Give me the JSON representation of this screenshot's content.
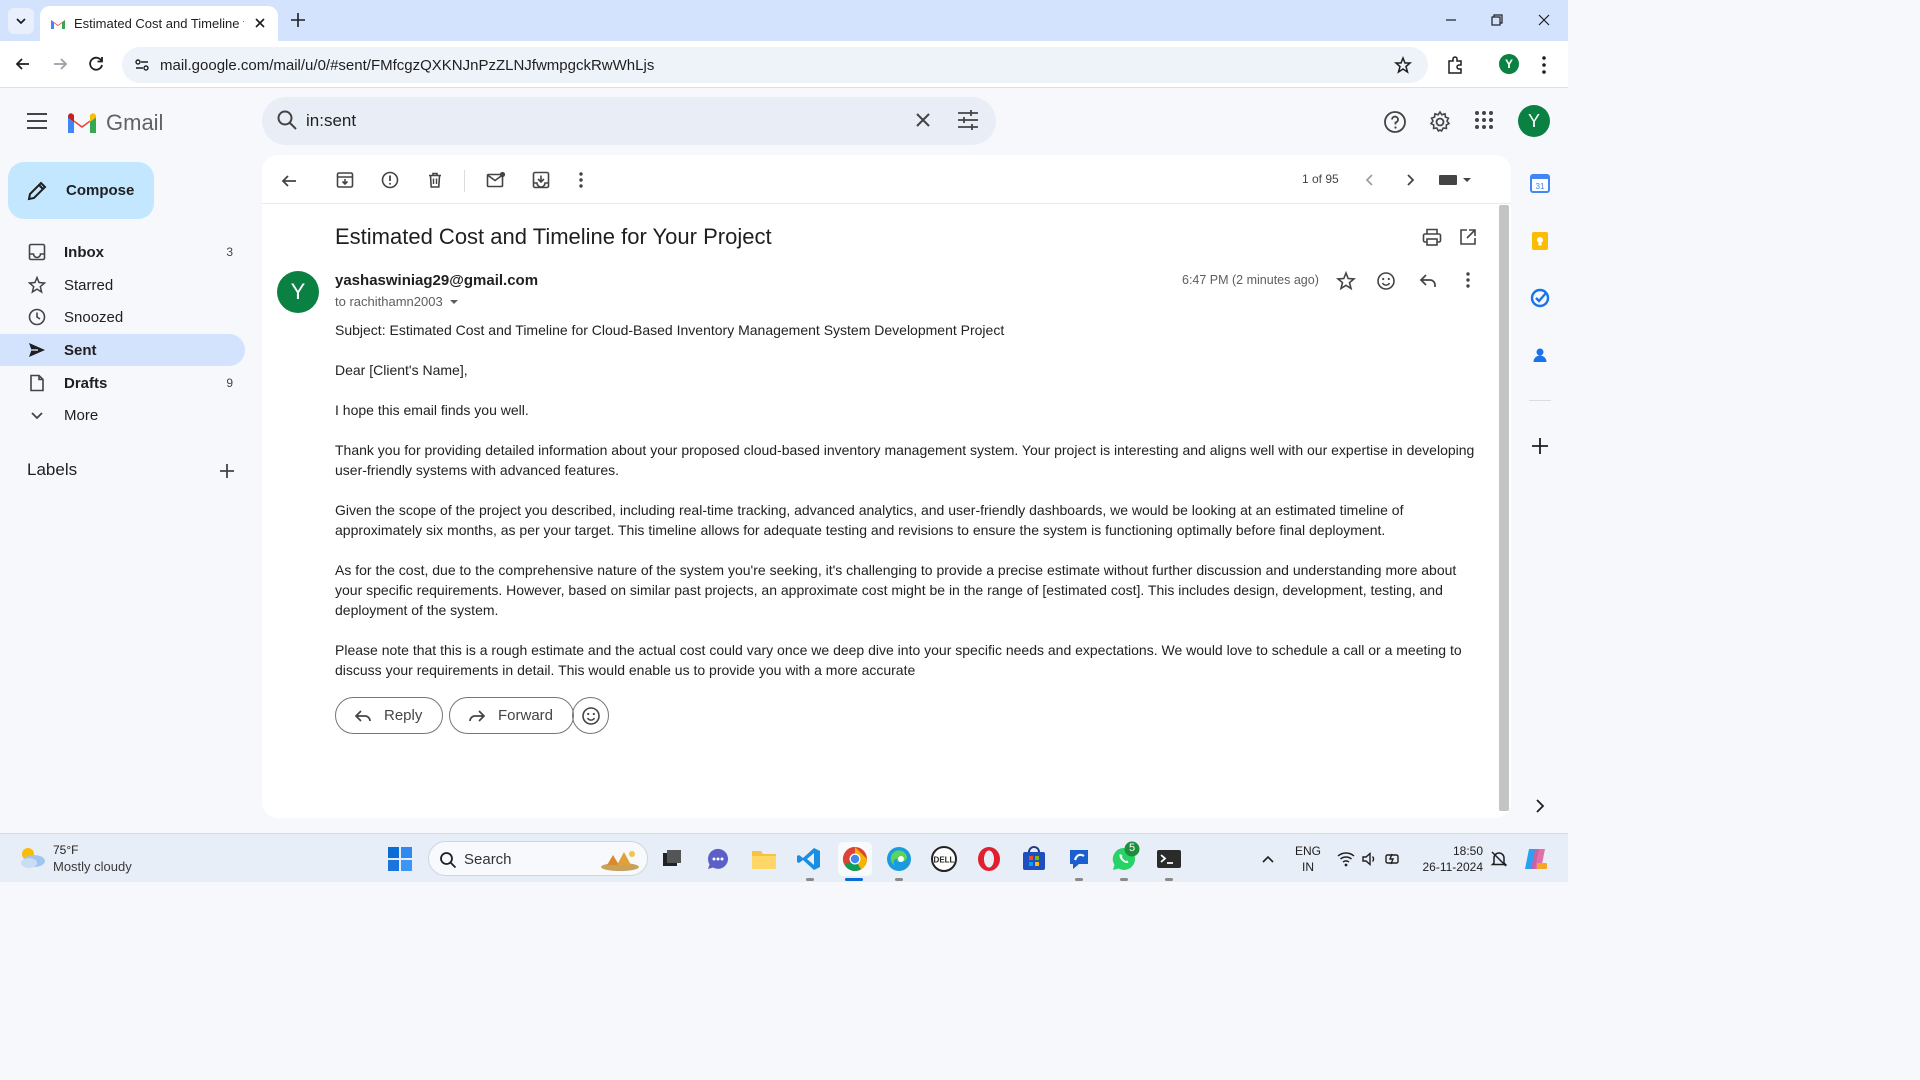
{
  "browser": {
    "tab_title": "Estimated Cost and Timeline for Your Project",
    "url": "mail.google.com/mail/u/0/#sent/FMfcgzQXKNJnPzZLNJfwmpgckRwWhLjs",
    "profile_initial": "Y"
  },
  "gmail": {
    "logo_text": "Gmail",
    "search_value": "in:sent",
    "avatar_initial": "Y",
    "compose_label": "Compose",
    "nav": [
      {
        "label": "Inbox",
        "count": "3",
        "bold": true
      },
      {
        "label": "Starred",
        "count": ""
      },
      {
        "label": "Snoozed",
        "count": ""
      },
      {
        "label": "Sent",
        "count": "",
        "bold": true,
        "active": true
      },
      {
        "label": "Drafts",
        "count": "9",
        "bold": true
      },
      {
        "label": "More",
        "count": ""
      }
    ],
    "labels_heading": "Labels",
    "pager": "1 of 95",
    "email": {
      "subject": "Estimated Cost and Timeline for Your Project",
      "sender_initial": "Y",
      "sender": "yashaswiniag29@gmail.com",
      "to": "to rachithamn2003",
      "time": "6:47 PM (2 minutes ago)",
      "body": [
        "Subject: Estimated Cost and Timeline for Cloud-Based Inventory Management System Development Project",
        "Dear [Client's Name],",
        "I hope this email finds you well.",
        "Thank you for providing detailed information about your proposed cloud-based inventory management system. Your project is interesting and aligns well with our expertise in developing user-friendly systems with advanced features.",
        "Given the scope of the project you described, including real-time tracking, advanced analytics, and user-friendly dashboards, we would be looking at an estimated timeline of approximately six months, as per your target. This timeline allows for adequate testing and revisions to ensure the system is functioning optimally before final deployment.",
        "As for the cost, due to the comprehensive nature of the system you're seeking, it's challenging to provide a precise estimate without further discussion and understanding more about your specific requirements. However, based on similar past projects, an approximate cost might be in the range of [estimated cost]. This includes design, development, testing, and deployment of the system.",
        "Please note that this is a rough estimate and the actual cost could vary once we deep dive into your specific needs and expectations. We would love to schedule a call or a meeting to discuss your requirements in detail. This would enable us to provide you with a more accurate"
      ],
      "reply_label": "Reply",
      "forward_label": "Forward"
    }
  },
  "taskbar": {
    "temperature": "75°F",
    "weather": "Mostly cloudy",
    "search_label": "Search",
    "whatsapp_badge": "5",
    "lang_top": "ENG",
    "lang_bottom": "IN",
    "time": "18:50",
    "date": "26-11-2024"
  },
  "colors": {
    "accent": "#0b57d0",
    "compose_bg": "#c2e7ff",
    "active_nav": "#d3e3fd",
    "avatar": "#0b8043"
  }
}
